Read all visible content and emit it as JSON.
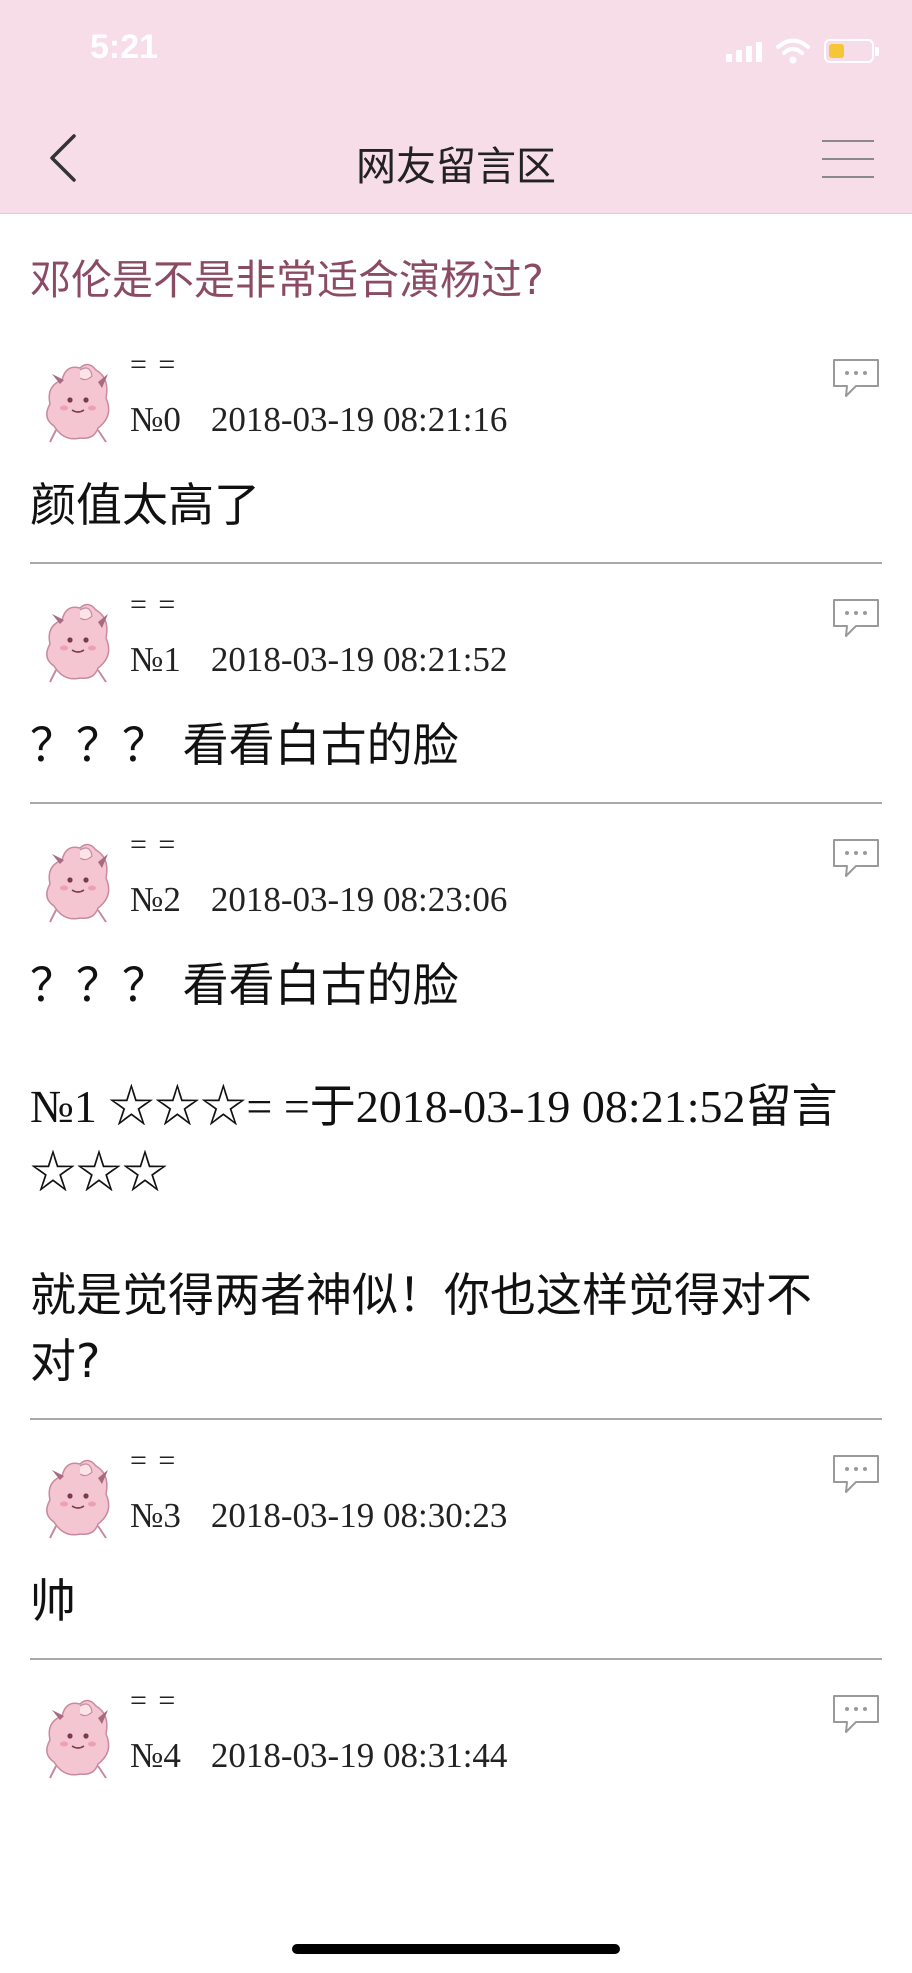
{
  "status_bar": {
    "time": "5:21",
    "battery_color": "#f5c635",
    "battery_level": 0.33
  },
  "nav": {
    "title": "网友留言区",
    "back_icon": "chevron-left-icon",
    "menu_icon": "hamburger-menu-icon"
  },
  "topic": "邓伦是不是非常适合演杨过?",
  "comments": [
    {
      "user": "= =",
      "no": "№0",
      "date": "2018-03-19 08:21:16",
      "lines": [
        "颜值太高了"
      ]
    },
    {
      "user": "= =",
      "no": "№1",
      "date": "2018-03-19 08:21:52",
      "lines": [
        "？？？ 看看白古的脸"
      ]
    },
    {
      "user": "= =",
      "no": "№2",
      "date": "2018-03-19 08:23:06",
      "lines": [
        "？？？ 看看白古的脸"
      ],
      "quote": "№1 ☆☆☆= =于2018-03-19 08:21:52留言☆☆☆",
      "reply": "就是觉得两者神似！你也这样觉得对不对?"
    },
    {
      "user": "= =",
      "no": "№3",
      "date": "2018-03-19 08:30:23",
      "lines": [
        "帅"
      ]
    },
    {
      "user": "= =",
      "no": "№4",
      "date": "2018-03-19 08:31:44",
      "lines": []
    }
  ],
  "colors": {
    "header_bg": "#f7dde8",
    "topic_color": "#8b4b63",
    "avatar_pink": "#f4c6d2"
  }
}
